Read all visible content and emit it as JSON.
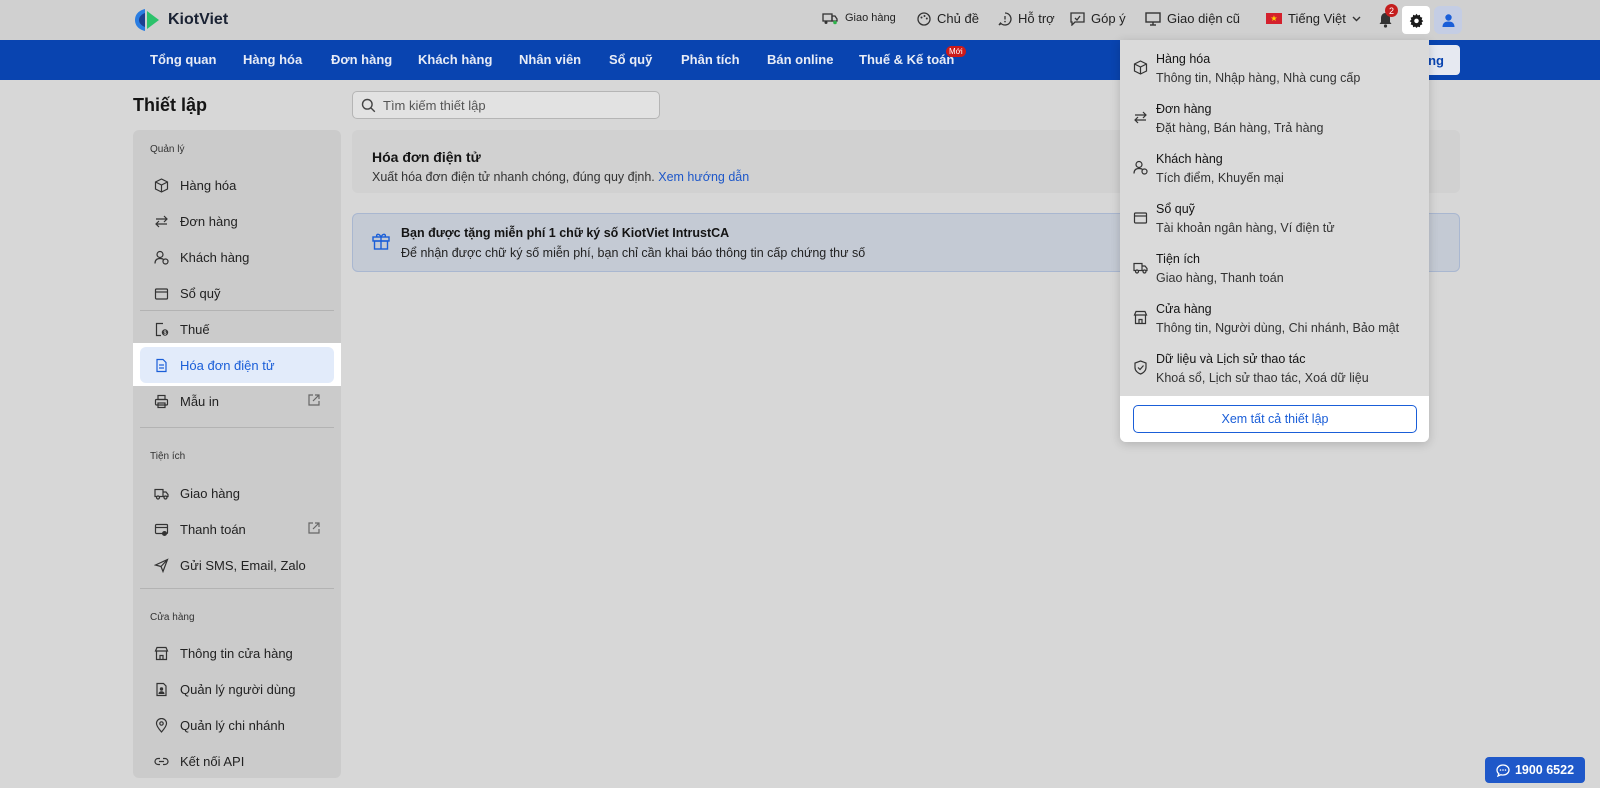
{
  "brand": {
    "name": "KiotViet"
  },
  "topbar": {
    "delivery": "Giao hàng",
    "theme": "Chủ đề",
    "support": "Hỗ trợ",
    "feedback": "Góp ý",
    "old_ui": "Giao diện cũ",
    "language": "Tiếng Việt",
    "notification_count": "2"
  },
  "nav": {
    "items": [
      "Tổng quan",
      "Hàng hóa",
      "Đơn hàng",
      "Khách hàng",
      "Nhân viên",
      "Sổ quỹ",
      "Phân tích",
      "Bán online",
      "Thuế & Kế toán"
    ],
    "new_badge": "Mới",
    "right_button": "ng"
  },
  "page": {
    "title": "Thiết lập",
    "search_placeholder": "Tìm kiếm thiết lập"
  },
  "sidebar": {
    "groups": [
      {
        "label": "Quản lý",
        "items": [
          "Hàng hóa",
          "Đơn hàng",
          "Khách hàng",
          "Sổ quỹ",
          "Thuế",
          "Hóa đơn điện tử",
          "Mẫu in"
        ]
      },
      {
        "label": "Tiện ích",
        "items": [
          "Giao hàng",
          "Thanh toán",
          "Gửi SMS, Email, Zalo"
        ]
      },
      {
        "label": "Cửa hàng",
        "items": [
          "Thông tin cửa hàng",
          "Quản lý người dùng",
          "Quản lý chi nhánh",
          "Kết nối API"
        ]
      }
    ],
    "active_item": "Hóa đơn điện tử"
  },
  "content": {
    "card_title": "Hóa đơn điện tử",
    "card_desc": "Xuất hóa đơn điện tử nhanh chóng, đúng quy định.",
    "card_link": "Xem hướng dẫn",
    "promo_title": "Bạn được tặng miễn phí 1 chữ ký số KiotViet IntrustCA",
    "promo_desc": "Để nhận được chữ ký số miễn phí, bạn chỉ cần khai báo thông tin cấp chứng thư số"
  },
  "dropdown": {
    "items": [
      {
        "title": "Hàng hóa",
        "subtitle": "Thông tin, Nhập hàng, Nhà cung cấp",
        "icon": "box-icon"
      },
      {
        "title": "Đơn hàng",
        "subtitle": "Đặt hàng, Bán hàng, Trả hàng",
        "icon": "swap-icon"
      },
      {
        "title": "Khách hàng",
        "subtitle": "Tích điểm, Khuyến mại",
        "icon": "customer-icon"
      },
      {
        "title": "Sổ quỹ",
        "subtitle": "Tài khoản ngân hàng, Ví điện tử",
        "icon": "wallet-icon"
      },
      {
        "title": "Tiện ích",
        "subtitle": "Giao hàng, Thanh toán",
        "icon": "truck-icon"
      },
      {
        "title": "Cửa hàng",
        "subtitle": "Thông tin, Người dùng, Chi nhánh, Bảo mật",
        "icon": "store-icon"
      },
      {
        "title": "Dữ liệu và Lịch sử thao tác",
        "subtitle": "Khoá sổ, Lịch sử thao tác, Xoá dữ liệu",
        "icon": "shield-icon"
      }
    ],
    "view_all": "Xem tất cả thiết lập"
  },
  "hotline": "1900 6522",
  "colors": {
    "primary": "#0944b0",
    "accent": "#1a5ed8",
    "badge": "#cc1a1a"
  }
}
